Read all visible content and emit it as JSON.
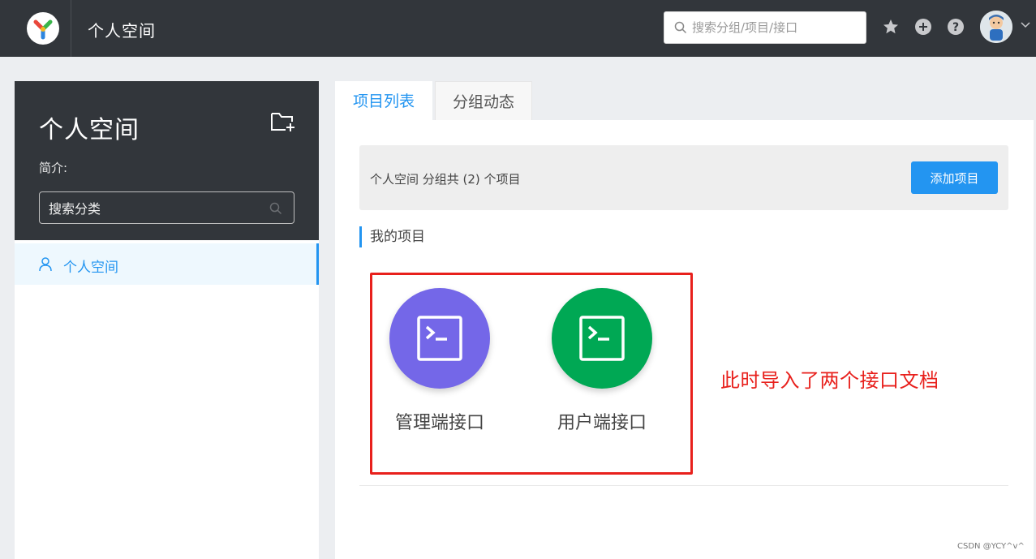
{
  "header": {
    "title": "个人空间",
    "search_placeholder": "搜索分组/项目/接口",
    "icons": [
      "logo-icon",
      "search-icon",
      "star-icon",
      "plus-icon",
      "help-icon",
      "avatar",
      "caret-down-icon"
    ]
  },
  "sidebar": {
    "title": "个人空间",
    "intro_label": "简介:",
    "search_placeholder": "搜索分类",
    "items": [
      {
        "label": "个人空间",
        "icon": "user-icon",
        "active": true
      }
    ]
  },
  "tabs": [
    {
      "label": "项目列表",
      "active": true
    },
    {
      "label": "分组动态",
      "active": false
    }
  ],
  "main": {
    "info_text": "个人空间 分组共 (2) 个项目",
    "add_button": "添加项目",
    "section_title": "我的项目",
    "projects": [
      {
        "name": "管理端接口",
        "color": "#7467e8",
        "icon": "terminal-icon"
      },
      {
        "name": "用户端接口",
        "color": "#00a854",
        "icon": "terminal-icon"
      }
    ]
  },
  "annotation": {
    "text": "此时导入了两个接口文档",
    "color": "#e8201c"
  },
  "watermark": "CSDN @YCY^v^",
  "colors": {
    "header_bg": "#32363b",
    "accent": "#2395f1",
    "page_bg": "#eceef1"
  }
}
